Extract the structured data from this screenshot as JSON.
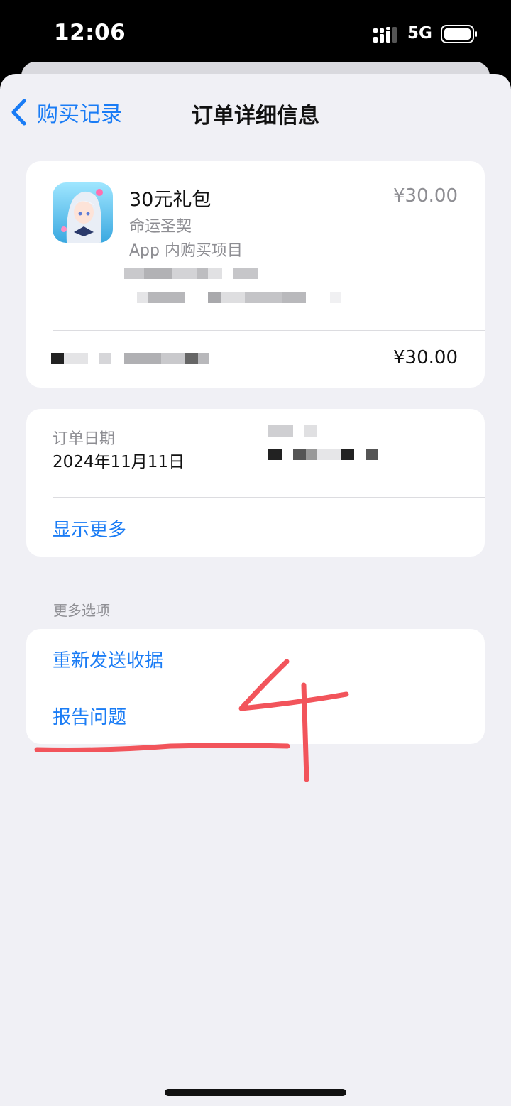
{
  "status_bar": {
    "time": "12:06",
    "network": "5G",
    "icons": [
      "signal-icon",
      "battery-icon"
    ]
  },
  "nav": {
    "back_label": "购买记录",
    "title": "订单详细信息",
    "back_icon": "chevron-left-icon"
  },
  "purchase": {
    "item_name": "30元礼包",
    "item_price": "¥30.00",
    "app_name": "命运圣契",
    "item_type": "App 内购买项目",
    "total_price": "¥30.00"
  },
  "order": {
    "date_label": "订单日期",
    "date_value": "2024年11月11日",
    "show_more": "显示更多"
  },
  "more_options": {
    "header": "更多选项",
    "resend_receipt": "重新发送收据",
    "report_problem": "报告问题"
  },
  "colors": {
    "accent": "#1a7cf5",
    "annotation": "#f2545b"
  }
}
